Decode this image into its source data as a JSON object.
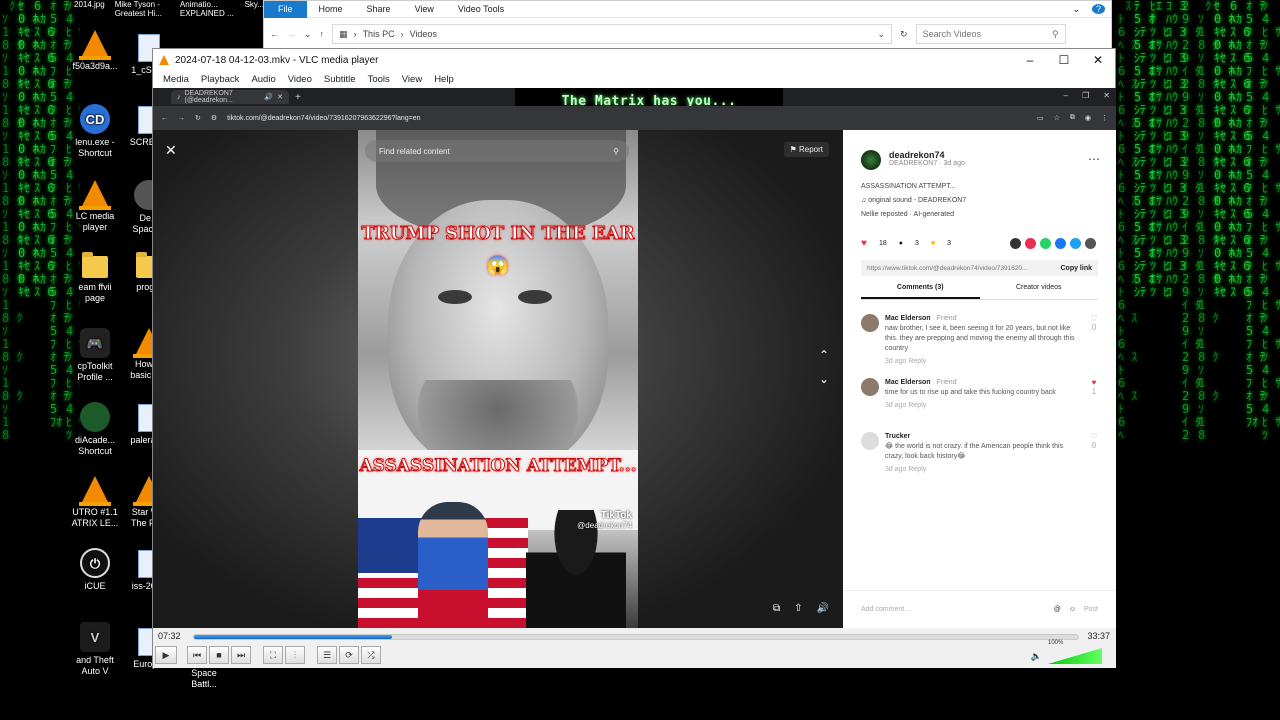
{
  "explorer": {
    "ribbon": [
      "File",
      "Home",
      "Share",
      "View",
      "Video Tools"
    ],
    "path": [
      "This PC",
      "Videos"
    ],
    "search_placeholder": "Search Videos"
  },
  "desktop": {
    "top_labels": [
      "2014.jpg",
      "Mike Tyson - Greatest Hi...",
      "Animatio... EXPLAINED ...",
      "Sky..."
    ],
    "icons": [
      {
        "label": "f50a3d9a...",
        "type": "vlc"
      },
      {
        "label": "1_cS-k...",
        "type": "doc"
      },
      {
        "label": "lenu.exe - Shortcut",
        "type": "cd"
      },
      {
        "label": "SCREE...",
        "type": "doc"
      },
      {
        "label": "LC media player",
        "type": "vlc"
      },
      {
        "label": "De... Space...",
        "type": "app"
      },
      {
        "label": "eam ffvii page",
        "type": "folder"
      },
      {
        "label": "prog...",
        "type": "folder"
      },
      {
        "label": "cpToolkit Profile ...",
        "type": "gamepad"
      },
      {
        "label": "How to basic C...",
        "type": "vlc"
      },
      {
        "label": "diAcade... Shortcut",
        "type": "app"
      },
      {
        "label": "paleraT...",
        "type": "doc"
      },
      {
        "label": "UTRO #1.1 ATRIX LE...",
        "type": "vlc"
      },
      {
        "label": "Star W... The Fo...",
        "type": "vlc"
      },
      {
        "label": "iCUE",
        "type": "icue"
      },
      {
        "label": "iss-20-...",
        "type": "doc"
      },
      {
        "label": "and Theft Auto V",
        "type": "gta"
      },
      {
        "label": "Europ...",
        "type": "app"
      },
      {
        "label": "Space Battl...",
        "type": "vlc"
      }
    ]
  },
  "vlc": {
    "title": "2024-07-18 04-12-03.mkv - VLC media player",
    "menu": [
      "Media",
      "Playback",
      "Audio",
      "Video",
      "Subtitle",
      "Tools",
      "View",
      "Help"
    ],
    "time_elapsed": "07:32",
    "time_total": "33:37",
    "progress": 0.224,
    "volume": "100%",
    "volume_level": 1.0
  },
  "browser": {
    "tab_title": "DEADREKON7 (@deadrekon...",
    "url": "tiktok.com/@deadrekon74/video/7391620796362296?lang=en",
    "banner_text": "The Matrix has you..."
  },
  "tiktok": {
    "search_placeholder": "Find related content",
    "report": "Report",
    "caption_top": "TRUMP SHOT IN THE EAR 😱",
    "caption_bottom": "ASSASSINATION ATTEMPT...",
    "watermark_brand": "TikTok",
    "watermark_handle": "@deadrekon74",
    "username": "deadrekon74",
    "handle_line": "DEADREKON7 · 3d ago",
    "description": "ASSASSINATION ATTEMPT...",
    "sound": "original sound - DEADREKON7",
    "reposted": "Nellie reposted · AI-generated",
    "likes": "18",
    "comments_count": "3",
    "saves": "3",
    "link": "https://www.tiktok.com/@deadrekon74/video/7391620...",
    "copy_link": "Copy link",
    "tab_comments": "Comments (3)",
    "tab_creator": "Creator videos",
    "comments": [
      {
        "name": "Mac Elderson",
        "tag": "· Friend",
        "text": "naw brother, I see it, been seeing it for 20 years, but not like this. they are prepping and moving the enemy all through this country",
        "meta": "3d ago  Reply",
        "likes": "0",
        "liked": false
      },
      {
        "name": "Mac Elderson",
        "tag": "· Friend",
        "text": "time for us to rise up and take this fucking country back",
        "meta": "3d ago  Reply",
        "likes": "1",
        "liked": true
      },
      {
        "name": "Trucker",
        "tag": "",
        "text": "😂 the world is not crazy. if the American people think this crazy, look back history😂",
        "meta": "3d ago  Reply",
        "likes": "0",
        "liked": false
      }
    ],
    "add_comment": "Add comment...",
    "post": "Post"
  }
}
